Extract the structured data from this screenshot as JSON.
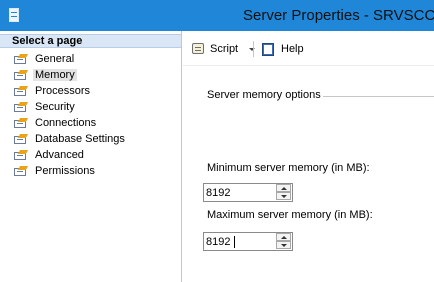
{
  "window": {
    "title": "Server Properties - SRVSCCM",
    "title_bar_color": "#1f86d8"
  },
  "sidebar": {
    "header": "Select a page",
    "items": [
      {
        "label": "General",
        "icon": "page-wrench-icon",
        "selected": false
      },
      {
        "label": "Memory",
        "icon": "page-wrench-icon",
        "selected": true
      },
      {
        "label": "Processors",
        "icon": "page-wrench-icon",
        "selected": false
      },
      {
        "label": "Security",
        "icon": "page-wrench-icon",
        "selected": false
      },
      {
        "label": "Connections",
        "icon": "page-wrench-icon",
        "selected": false
      },
      {
        "label": "Database Settings",
        "icon": "page-wrench-icon",
        "selected": false
      },
      {
        "label": "Advanced",
        "icon": "page-wrench-icon",
        "selected": false
      },
      {
        "label": "Permissions",
        "icon": "page-wrench-icon",
        "selected": false
      }
    ]
  },
  "toolbar": {
    "script_label": "Script",
    "help_label": "Help"
  },
  "memory": {
    "group_title": "Server memory options",
    "min_label": "Minimum server memory (in MB):",
    "min_value": "8192",
    "max_label": "Maximum server memory (in MB):",
    "max_value": "8192"
  }
}
